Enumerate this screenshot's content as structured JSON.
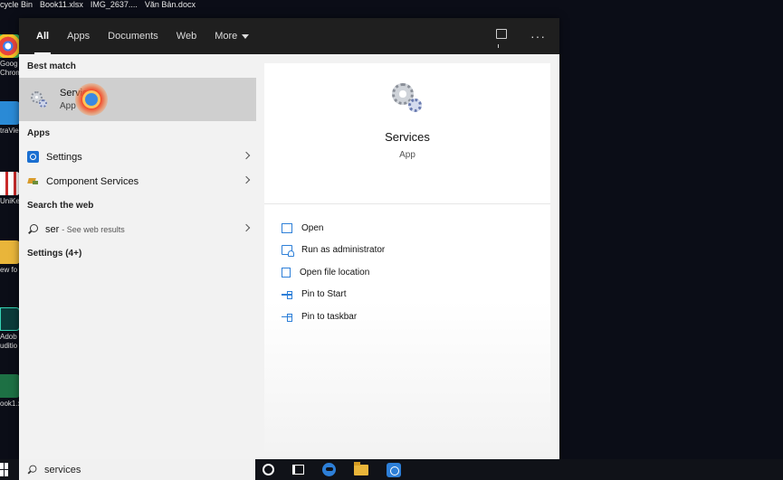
{
  "desktop": {
    "top_files": [
      "cycle Bin",
      "Book11.xlsx",
      "IMG_2637....",
      "Văn Bản.docx"
    ],
    "icons": [
      {
        "name": "chrome",
        "label_lines": [
          "Goog",
          "Chrom"
        ],
        "color": "#e8453c"
      },
      {
        "name": "ultraviewer",
        "label_lines": [
          "traVie"
        ],
        "color": "#2a8ad6"
      },
      {
        "name": "unikey",
        "label_lines": [
          "UniKe"
        ],
        "color": "#c92a2a"
      },
      {
        "name": "folder",
        "label_lines": [
          "ew fo"
        ],
        "color": "#e9b53a"
      },
      {
        "name": "audition",
        "label_lines": [
          "Adob",
          "uditio"
        ],
        "color": "#0b3b3a"
      },
      {
        "name": "excel",
        "label_lines": [
          "ook1.x"
        ],
        "color": "#1d7044"
      }
    ]
  },
  "tabs": [
    {
      "label": "All",
      "active": true
    },
    {
      "label": "Apps",
      "active": false
    },
    {
      "label": "Documents",
      "active": false
    },
    {
      "label": "Web",
      "active": false
    },
    {
      "label": "More",
      "active": false,
      "has_caret": true
    }
  ],
  "sections": {
    "best_match": "Best match",
    "apps": "Apps",
    "web": "Search the web",
    "settings": "Settings (4+)"
  },
  "best_match": {
    "title": "Services",
    "subtitle": "App"
  },
  "apps": [
    {
      "label": "Settings",
      "icon": "settings-gear-icon"
    },
    {
      "label": "Component Services",
      "icon": "component-services-icon"
    }
  ],
  "web_result": {
    "query": "ser",
    "suffix": "- See web results"
  },
  "detail": {
    "title": "Services",
    "subtitle": "App",
    "actions": [
      {
        "label": "Open",
        "icon": "open-icon"
      },
      {
        "label": "Run as administrator",
        "icon": "run-as-admin-icon"
      },
      {
        "label": "Open file location",
        "icon": "file-location-icon"
      },
      {
        "label": "Pin to Start",
        "icon": "pin-icon"
      },
      {
        "label": "Pin to taskbar",
        "icon": "pin-icon"
      }
    ]
  },
  "taskbar": {
    "search_value": "services"
  },
  "colors": {
    "panel_bg": "#f2f2f2",
    "tabbar_bg": "#1f1f1f",
    "accent": "#2d7fd8",
    "selected_bg": "#cfcfcf"
  }
}
